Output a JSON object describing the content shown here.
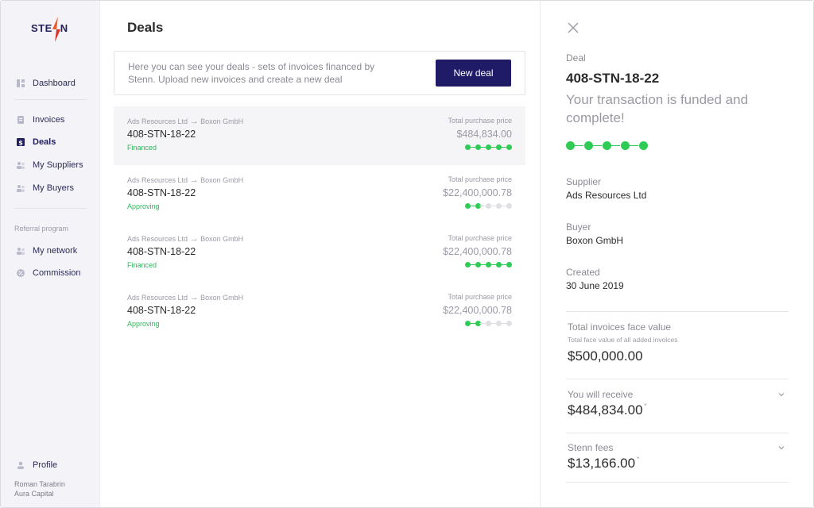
{
  "brand": {
    "logo_left": "STE",
    "logo_right": "N"
  },
  "sidebar": {
    "items": [
      {
        "label": "Dashboard",
        "icon": "dashboard-icon"
      },
      {
        "label": "Invoices",
        "icon": "invoice-icon"
      },
      {
        "label": "Deals",
        "icon": "dollar-icon"
      },
      {
        "label": "My Suppliers",
        "icon": "people-icon"
      },
      {
        "label": "My Buyers",
        "icon": "people-icon"
      }
    ],
    "referral_label": "Referral program",
    "referral_items": [
      {
        "label": "My network",
        "icon": "people-icon"
      },
      {
        "label": "Commission",
        "icon": "percent-icon"
      }
    ],
    "profile": {
      "label": "Profile",
      "user_name": "Roman Tarabrin",
      "company": "Aura Capital"
    }
  },
  "main": {
    "title": "Deals",
    "info_text": "Here you can see your deals - sets of invoices financed by Stenn. Upload new invoices and create a new deal",
    "new_deal_label": "New deal",
    "deals": [
      {
        "supplier": "Ads Resources Ltd",
        "buyer": "Boxon GmbH",
        "arrow": "→",
        "id": "408-STN-18-22",
        "status": "Financed",
        "price_label": "Total purchase price",
        "price": "$484,834.00",
        "progress": 5
      },
      {
        "supplier": "Ads Resources Ltd",
        "buyer": "Boxon GmbH",
        "arrow": "→",
        "id": "408-STN-18-22",
        "status": "Approving",
        "price_label": "Total purchase price",
        "price": "$22,400,000.78",
        "progress": 2
      },
      {
        "supplier": "Ads Resources Ltd",
        "buyer": "Boxon GmbH",
        "arrow": "→",
        "id": "408-STN-18-22",
        "status": "Financed",
        "price_label": "Total purchase price",
        "price": "$22,400,000.78",
        "progress": 5
      },
      {
        "supplier": "Ads Resources Ltd",
        "buyer": "Boxon GmbH",
        "arrow": "→",
        "id": "408-STN-18-22",
        "status": "Approving",
        "price_label": "Total purchase price",
        "price": "$22,400,000.78",
        "progress": 2
      }
    ]
  },
  "detail": {
    "deal_label": "Deal",
    "deal_id": "408-STN-18-22",
    "headline": "Your transaction is funded and complete!",
    "progress": 5,
    "supplier_label": "Supplier",
    "supplier": "Ads Resources Ltd",
    "buyer_label": "Buyer",
    "buyer": "Boxon GmbH",
    "created_label": "Created",
    "created": "30 June 2019",
    "total_face_label": "Total invoices face value",
    "total_face_sub": "Total face value of all added invoices",
    "total_face": "$500,000.00",
    "receive_label": "You will receive",
    "receive": "$484,834.00",
    "fees_label": "Stenn fees",
    "fees": "$13,166.00",
    "footnote_mark": "*"
  },
  "colors": {
    "accent": "#201b66",
    "success": "#2ecc55",
    "logo_orange": "#f05a28"
  }
}
